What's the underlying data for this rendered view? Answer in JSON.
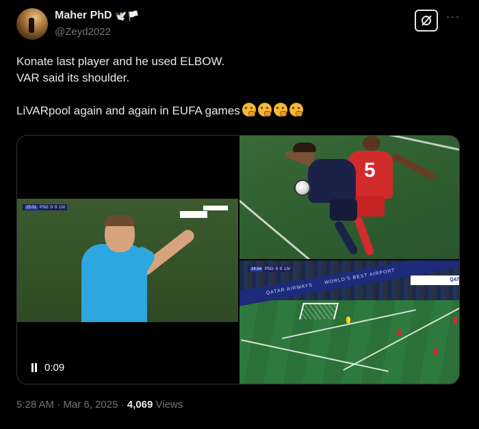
{
  "user": {
    "display_name": "Maher PhD",
    "name_emojis": "🕊️🏳️",
    "handle": "@Zeyd2022"
  },
  "tweet": {
    "lines": [
      "Konate last player and he used ELBOW.",
      "VAR said its shoulder.",
      "",
      "LiVARpool again and again in EUFA games"
    ],
    "thinking_emoji_count": 4
  },
  "media": {
    "video": {
      "time": "0:09",
      "score_bug": {
        "clock": "25:01",
        "home": "PSG",
        "home_score": "0",
        "away_score": "0",
        "away": "LIV"
      }
    },
    "top_right": {
      "shirt_number": "5"
    },
    "bottom_right": {
      "score_bug": {
        "clock": "24:54",
        "home": "PSG",
        "home_score": "0",
        "away_score": "0",
        "away": "LIV"
      },
      "ad_text": "QATAR AIRWAYS",
      "ad_text_2": "WORLD'S BEST AIRPORT",
      "ad_text_3": "QATA"
    }
  },
  "footer": {
    "time": "5:28 AM",
    "sep1": "·",
    "date": "Mar 6, 2025",
    "sep2": "·",
    "views_count": "4,069",
    "views_label": "Views"
  },
  "colors": {
    "background": "#000000",
    "text": "#e7e9ea",
    "secondary": "#71767b",
    "border": "#2f3336"
  }
}
